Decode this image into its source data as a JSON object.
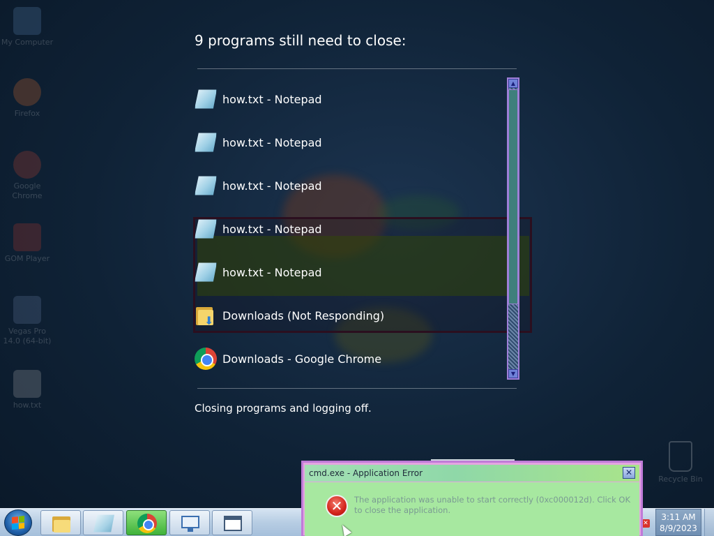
{
  "desktop": {
    "icons": [
      {
        "label": "My Computer"
      },
      {
        "label": "Firefox"
      },
      {
        "label": "Google Chrome"
      },
      {
        "label": "GOM Player"
      },
      {
        "label": "Vegas Pro 14.0 (64-bit)"
      },
      {
        "label": "how.txt"
      }
    ],
    "recycle_bin": "Recycle Bin"
  },
  "logoff": {
    "heading": "9 programs still need to close:",
    "programs": [
      {
        "label": "how.txt - Notepad",
        "icon": "notepad-icon"
      },
      {
        "label": "how.txt - Notepad",
        "icon": "notepad-icon"
      },
      {
        "label": "how.txt - Notepad",
        "icon": "notepad-icon"
      },
      {
        "label": "how.txt - Notepad",
        "icon": "notepad-icon"
      },
      {
        "label": "how.txt - Notepad",
        "icon": "notepad-icon"
      },
      {
        "label": "Downloads (Not Responding)",
        "icon": "folder-icon"
      },
      {
        "label": "Downloads - Google Chrome",
        "icon": "chrome-icon"
      }
    ],
    "status": "Closing programs and logging off."
  },
  "dialog": {
    "title": "cmd.exe - Application Error",
    "close_glyph": "✕",
    "message": "The application was unable to start correctly (0xc000012d). Click OK to close the application."
  },
  "taskbar": {
    "buttons": [
      {
        "icon": "folder-icon"
      },
      {
        "icon": "notepad-icon"
      },
      {
        "icon": "chrome-icon",
        "active": true
      },
      {
        "icon": "network-icon"
      },
      {
        "icon": "window-icon"
      }
    ],
    "time": "3:11 AM",
    "date": "8/9/2023"
  }
}
